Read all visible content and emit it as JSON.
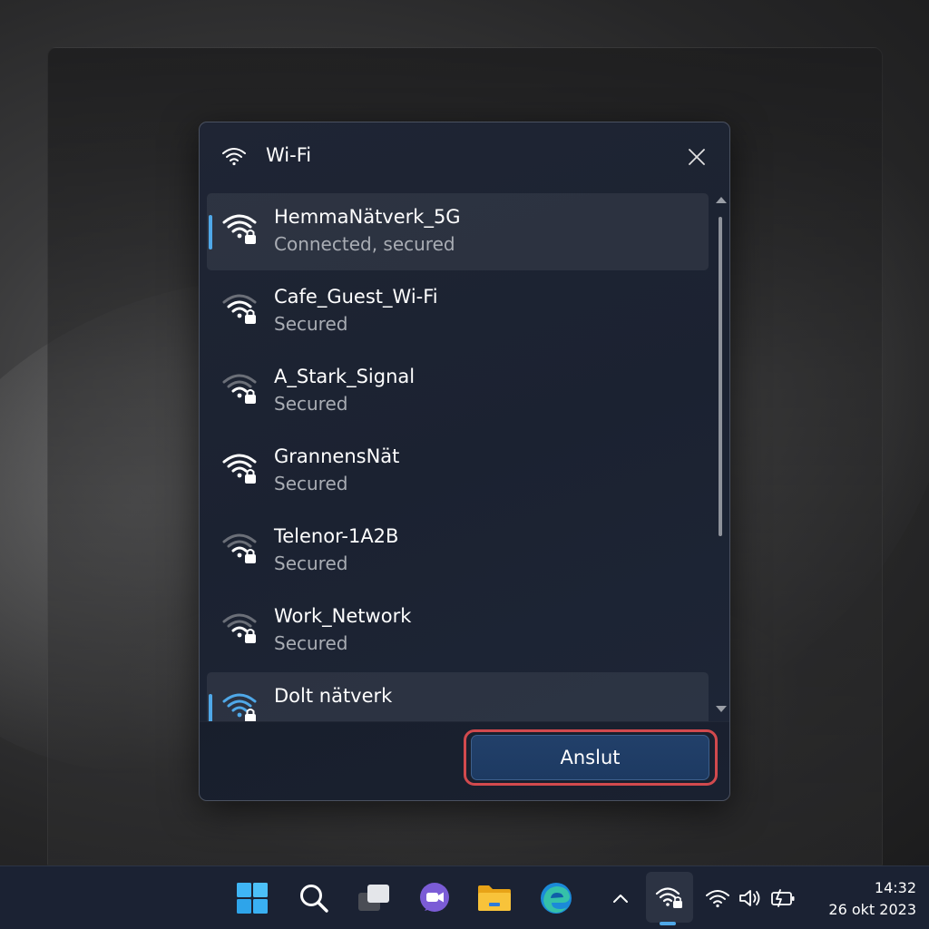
{
  "flyout": {
    "title": "Wi-Fi",
    "title_icon": "wifi-icon",
    "close_icon": "close-icon",
    "networks": [
      {
        "name": "HemmaNätverk_5G",
        "status": "Connected, secured",
        "selected": true,
        "signal": 4
      },
      {
        "name": "Cafe_Guest_Wi-Fi",
        "status": "Secured",
        "selected": false,
        "signal": 3
      },
      {
        "name": "A_Stark_Signal",
        "status": "Secured",
        "selected": false,
        "signal": 2
      },
      {
        "name": "GrannensNät",
        "status": "Secured",
        "selected": false,
        "signal": 4
      },
      {
        "name": "Telenor-1A2B",
        "status": "Secured",
        "selected": false,
        "signal": 2
      },
      {
        "name": "Work_Network",
        "status": "Secured",
        "selected": false,
        "signal": 2
      },
      {
        "name": "Dolt nätverk",
        "status": "",
        "selected": true,
        "signal": 4
      }
    ],
    "connect_label": "Anslut"
  },
  "taskbar": {
    "icons": [
      "windows-start-icon",
      "search-icon",
      "task-view-icon",
      "teams-chat-icon",
      "file-explorer-icon",
      "edge-browser-icon"
    ],
    "tray_icons": [
      "chevron-up-icon",
      "wifi-locked-icon",
      "wifi-icon",
      "volume-icon",
      "battery-icon"
    ],
    "time": "14:32",
    "date": "26 okt 2023"
  },
  "colors": {
    "accent": "#4fa8e8",
    "highlight_border": "#d24a4e",
    "flyout_bg": "#1d2433",
    "button_bg": "#22406a"
  }
}
